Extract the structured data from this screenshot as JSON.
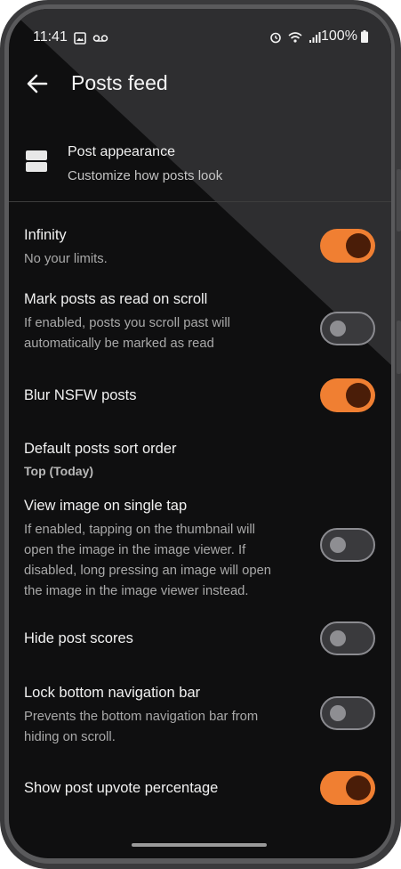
{
  "status_bar": {
    "time": "11:41",
    "battery": "100%"
  },
  "app_bar": {
    "title": "Posts feed"
  },
  "section": {
    "title": "Post appearance",
    "subtitle": "Customize how posts look"
  },
  "settings": [
    {
      "title": "Infinity",
      "subtitle": "No your limits.",
      "enabled": true
    },
    {
      "title": "Mark posts as read on scroll",
      "subtitle_lines": [
        "If enabled, posts you scroll past will",
        "automatically be marked as read"
      ],
      "enabled": false
    },
    {
      "title": "Blur NSFW posts",
      "enabled": true
    },
    {
      "title": "Default posts sort order",
      "value": "Top (Today)"
    },
    {
      "title": "View image on single tap",
      "subtitle_lines": [
        "If enabled, tapping on the thumbnail will",
        "open the image in the image viewer. If",
        "disabled, long pressing an image will open",
        "the image in the image viewer instead."
      ],
      "enabled": false
    },
    {
      "title": "Hide post scores",
      "enabled": false
    },
    {
      "title": "Lock bottom navigation bar",
      "subtitle_lines": [
        "Prevents the bottom navigation bar from",
        "hiding on scroll."
      ],
      "enabled": false
    },
    {
      "title": "Show post upvote percentage",
      "enabled": true
    }
  ],
  "colors": {
    "accent": "#f07f32",
    "background": "#0f0f10"
  }
}
